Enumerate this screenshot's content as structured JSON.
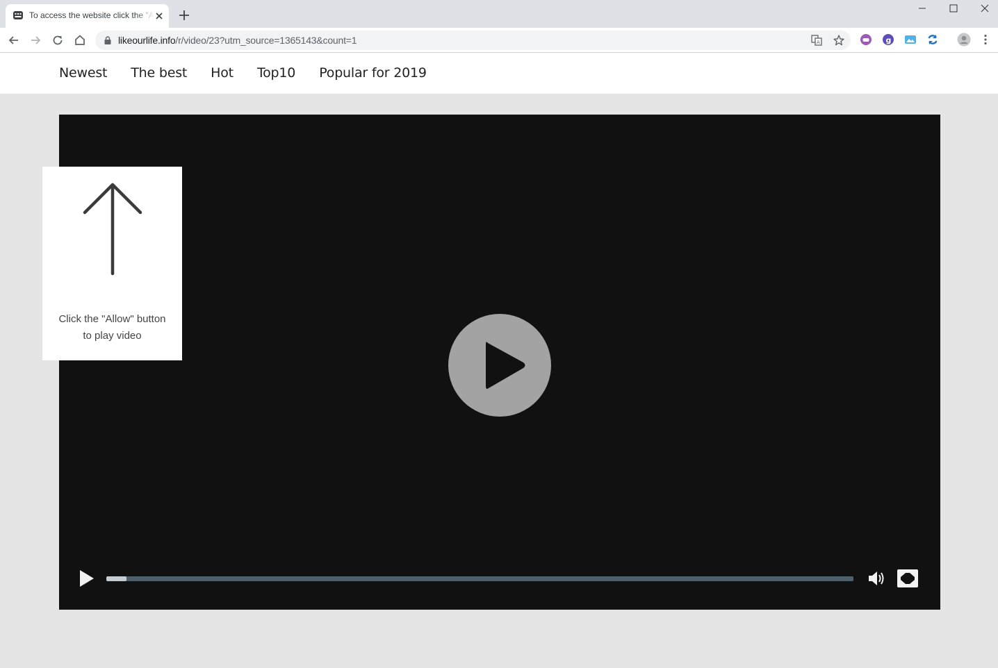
{
  "browser": {
    "tab_title": "To access the website click the \"Allow\" button",
    "url_host": "likeourlife.info",
    "url_path": "/r/video/23?utm_source=1365143&count=1"
  },
  "site_nav": [
    "Newest",
    "The best",
    "Hot",
    "Top10",
    "Popular for 2019"
  ],
  "player": {
    "progress": 0.027
  },
  "popup": {
    "text_line1": "Click the \"Allow\" button",
    "text_line2": "to play video"
  },
  "icons": {
    "extensions": [
      "gamepad-extension-icon",
      "shield-extension-icon",
      "image-extension-icon",
      "sync-extension-icon"
    ]
  }
}
